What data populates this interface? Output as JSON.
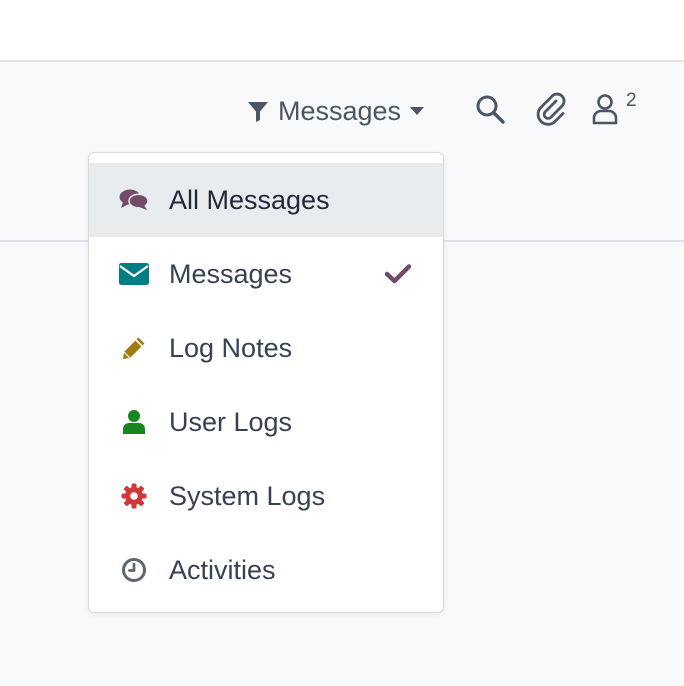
{
  "toolbar": {
    "filter_label": "Messages",
    "search_icon": "search-icon",
    "attachment_icon": "paperclip-icon",
    "followers_icon": "user-icon",
    "followers_count": "2"
  },
  "menu": {
    "items": [
      {
        "label": "All Messages",
        "icon": "comments-icon",
        "color": "#714b67",
        "active": true,
        "checked": false
      },
      {
        "label": "Messages",
        "icon": "envelope-icon",
        "color": "#017e84",
        "active": false,
        "checked": true
      },
      {
        "label": "Log Notes",
        "icon": "pencil-icon",
        "color": "#a07b12",
        "active": false,
        "checked": false
      },
      {
        "label": "User Logs",
        "icon": "user-icon",
        "color": "#16861e",
        "active": false,
        "checked": false
      },
      {
        "label": "System Logs",
        "icon": "gear-icon",
        "color": "#d0393a",
        "active": false,
        "checked": false
      },
      {
        "label": "Activities",
        "icon": "clock-icon",
        "color": "#5f6670",
        "active": false,
        "checked": false
      }
    ],
    "check_color": "#714b67"
  }
}
